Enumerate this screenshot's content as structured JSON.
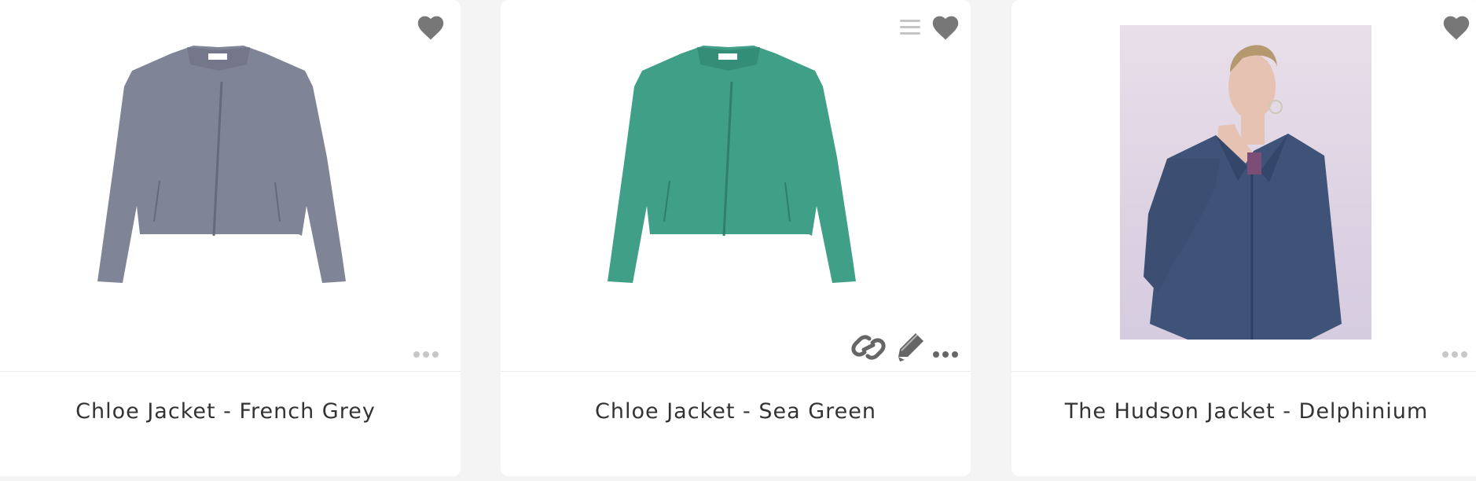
{
  "products": [
    {
      "title": "Chloe Jacket - French Grey",
      "image_alt": "Grey zip-front jacket",
      "jacket_color": "#7f8497",
      "more_icon_color": "#c7c7c7",
      "is_hovered": false
    },
    {
      "title": "Chloe Jacket - Sea Green",
      "image_alt": "Sea green zip-front jacket",
      "jacket_color": "#3f9f87",
      "more_icon_color": "#666666",
      "is_hovered": true
    },
    {
      "title": "The Hudson Jacket - Delphinium",
      "image_alt": "Model wearing navy suede jacket",
      "jacket_color": "#3f5378",
      "more_icon_color": "#c7c7c7",
      "is_hovered": false
    }
  ],
  "icons": {
    "heart": "heart-icon",
    "drag": "drag-handle-icon",
    "link": "link-icon",
    "edit": "pencil-icon",
    "more": "more-horizontal-icon"
  },
  "colors": {
    "heart": "#777777",
    "page_background": "#f4f4f4",
    "card_background": "#ffffff",
    "text": "#333333"
  }
}
